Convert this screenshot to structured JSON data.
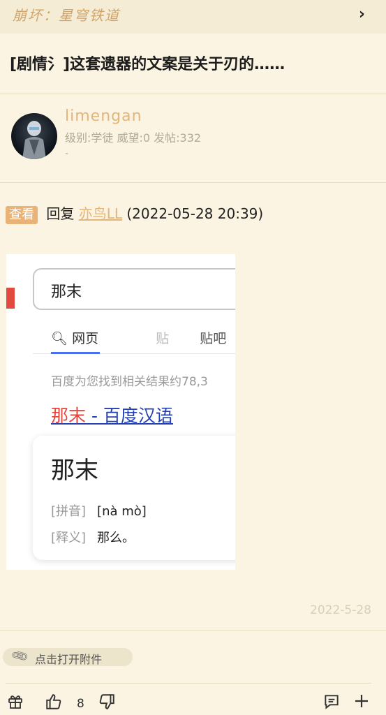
{
  "topbar": {
    "forum_name": "崩坏：星穹铁道",
    "chevron": "›"
  },
  "post": {
    "title": "[剧情氵]这套遗器的文案是关于刃的……"
  },
  "author": {
    "username": "limengan",
    "meta": "级别:学徒 威望:0 发帖:332",
    "signature": "-"
  },
  "reply": {
    "tag": "查看",
    "prefix": "回复",
    "target_user": "亦鸟LL",
    "time": "(2022-05-28 20:39)"
  },
  "embed": {
    "query": "那末",
    "tabs": [
      "网页",
      "贴吧",
      "知"
    ],
    "result_count": "百度为您找到相关结果约78,3",
    "result_link_hl": "那末",
    "result_link_rest": " - 百度汉语",
    "card_word": "那末",
    "pinyin_label": "[拼音]",
    "pinyin_value": "[nà mò]",
    "meaning_label": "[释义]",
    "meaning_value": "那么。"
  },
  "post_date": "2022-5-28",
  "attachment": {
    "label": "点击打开附件"
  },
  "actions": {
    "like_count": "8"
  },
  "colors": {
    "background": "#fbf4e2",
    "accent": "#e2b67a",
    "tag": "#e9b377"
  }
}
